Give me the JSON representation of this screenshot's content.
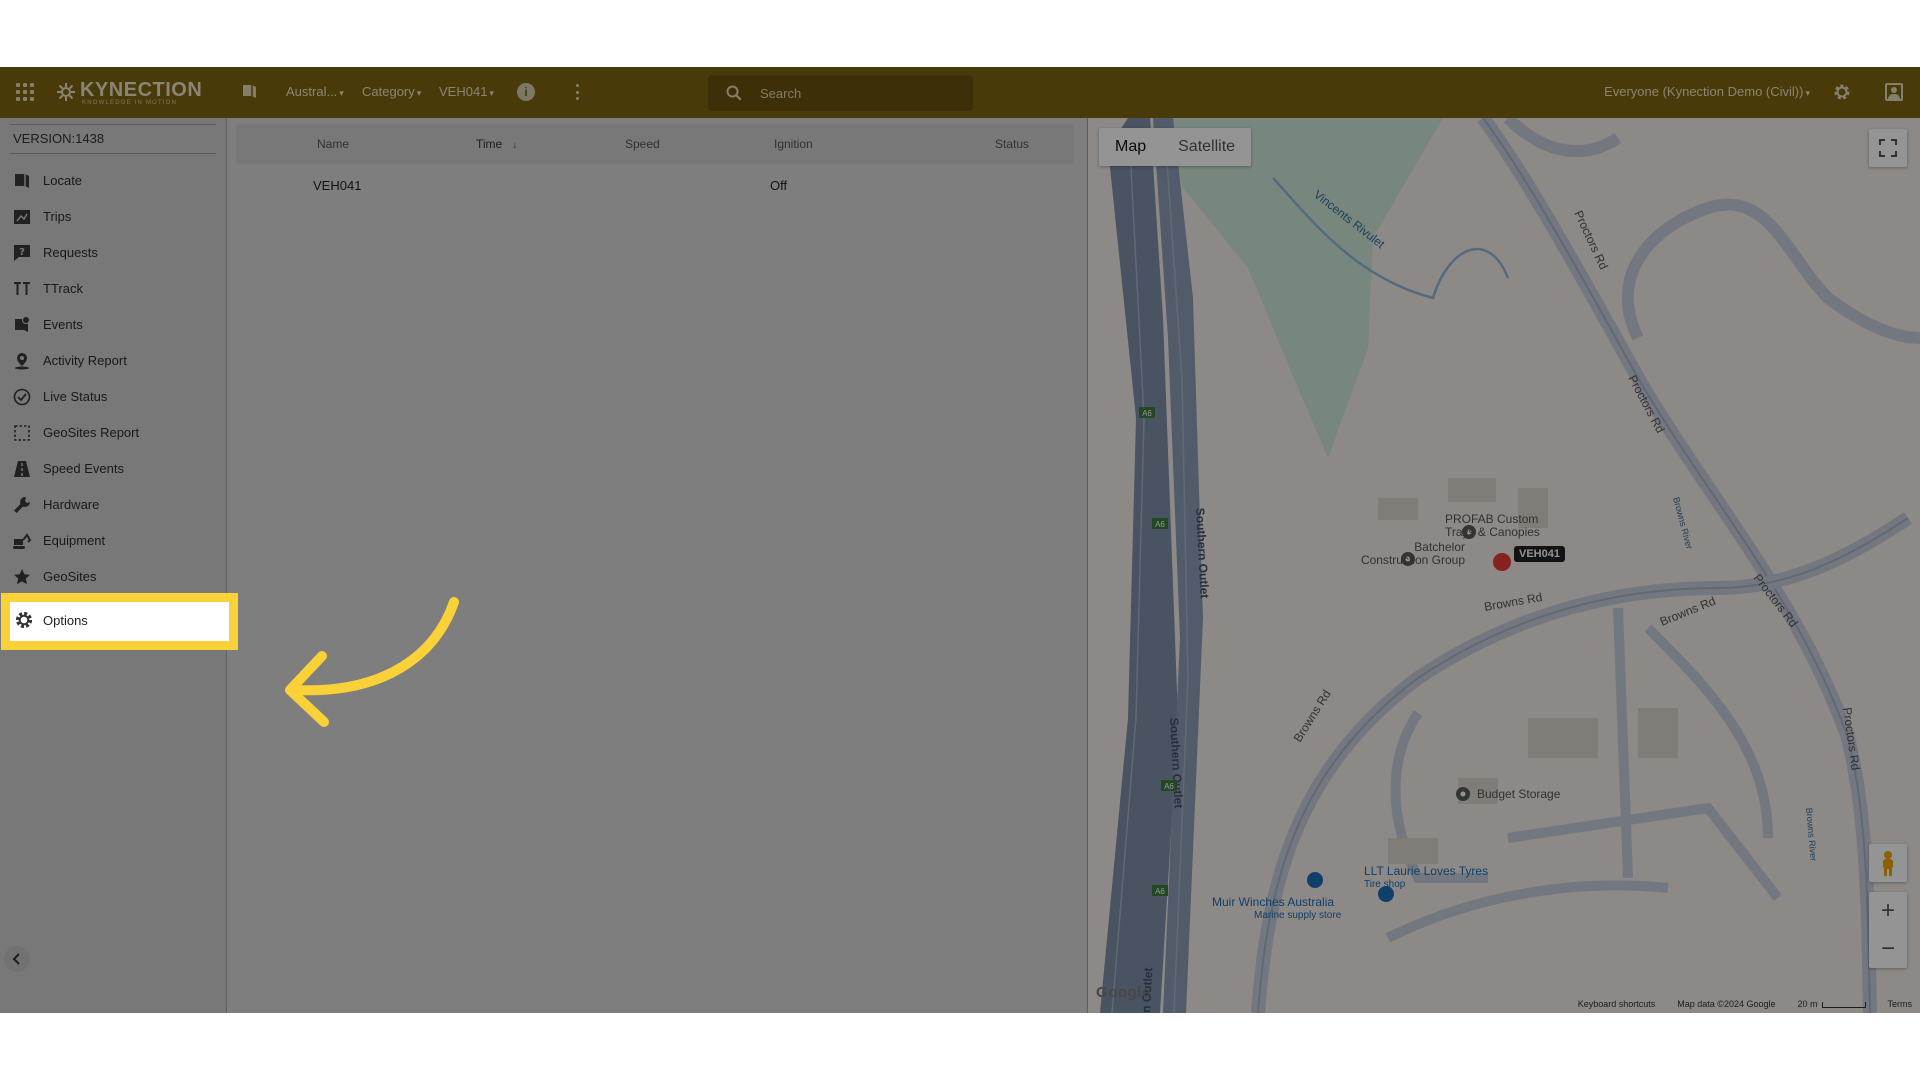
{
  "header": {
    "logo_text": "KYNECTION",
    "logo_tagline": "KNOWLEDGE IN MOTION",
    "region_dropdown": "Austral...",
    "category_dropdown": "Category",
    "vehicle_dropdown": "VEH041",
    "search_placeholder": "Search",
    "account_label": "Everyone (Kynection Demo (Civil))",
    "colors": {
      "bar": "#7d6410",
      "highlight": "#fbd13a"
    }
  },
  "sidebar": {
    "version": "VERSION:1438",
    "items": [
      {
        "label": "Locate",
        "icon": "map-book-icon"
      },
      {
        "label": "Trips",
        "icon": "trips-icon"
      },
      {
        "label": "Requests",
        "icon": "question-icon"
      },
      {
        "label": "TTrack",
        "icon": "ttrack-icon"
      },
      {
        "label": "Events",
        "icon": "events-icon"
      },
      {
        "label": "Activity Report",
        "icon": "person-pin-icon"
      },
      {
        "label": "Live Status",
        "icon": "check-circle-icon"
      },
      {
        "label": "GeoSites Report",
        "icon": "dashed-square-icon"
      },
      {
        "label": "Speed Events",
        "icon": "road-icon"
      },
      {
        "label": "Hardware",
        "icon": "wrench-icon"
      },
      {
        "label": "Equipment",
        "icon": "excavator-icon"
      },
      {
        "label": "GeoSites",
        "icon": "star-icon"
      }
    ],
    "options_label": "Options"
  },
  "table": {
    "columns": [
      "Name",
      "Time",
      "Speed",
      "Ignition",
      "Status"
    ],
    "sort_indicator": "↓",
    "rows": [
      {
        "name": "VEH041",
        "time": "",
        "speed": "",
        "ignition": "Off",
        "status": ""
      }
    ]
  },
  "map": {
    "types": [
      "Map",
      "Satellite"
    ],
    "active_type": "Map",
    "vehicle_label": "VEH041",
    "labels": {
      "profab": "PROFAB Custom Trays & Canopies",
      "profab_l1": "PROFAB Custom",
      "profab_l2": "Trays & Canopies",
      "batchelor_l1": "Batchelor",
      "batchelor_l2": "Construction Group",
      "budget": "Budget Storage",
      "llt": "LLT Laurie Loves Tyres",
      "llt_sub": "Tire shop",
      "muir": "Muir Winches Australia",
      "muir_sub": "Marine supply store",
      "vincents": "Vincents Rivulet",
      "proctors": "Proctors Rd",
      "browns": "Browns Rd",
      "browns_river": "Browns River",
      "southern_outlet": "Southern Outlet",
      "outlet_partial": "n Outlet",
      "a6": "A6"
    },
    "google_logo": "Google",
    "attribution": {
      "shortcuts": "Keyboard shortcuts",
      "data": "Map data ©2024 Google",
      "scale": "20 m",
      "terms": "Terms"
    }
  }
}
